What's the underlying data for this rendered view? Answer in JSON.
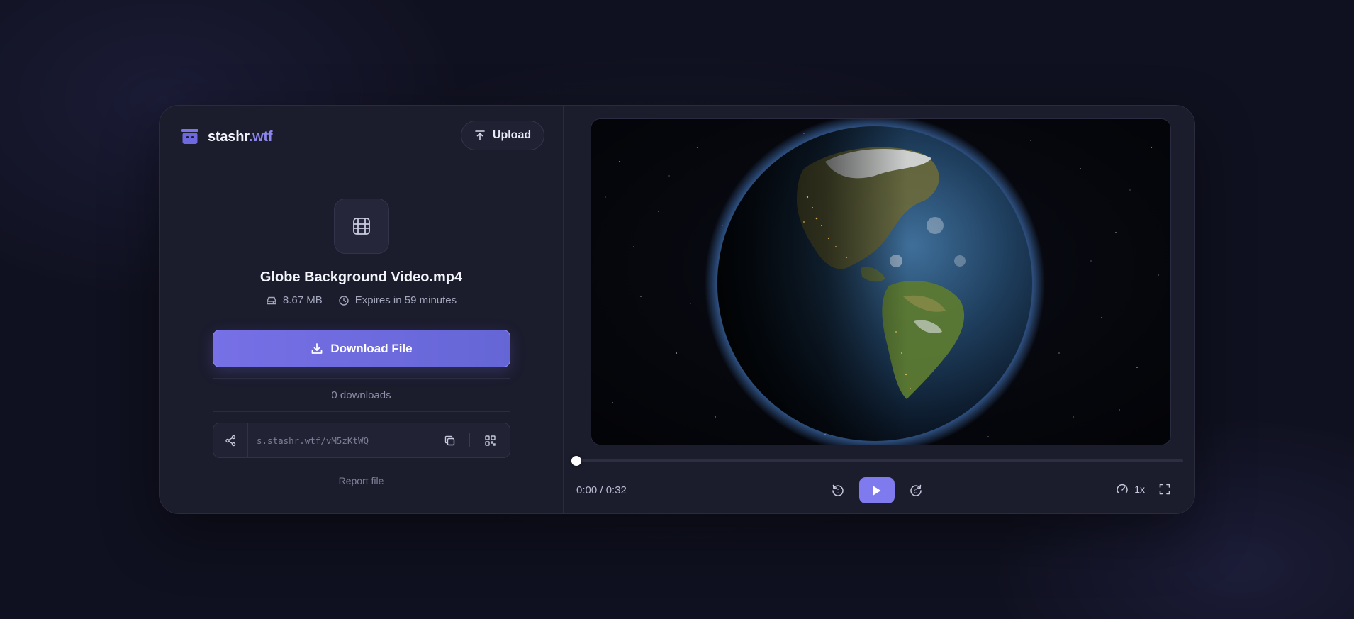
{
  "brand": {
    "name": "stashr",
    "tld": ".wtf"
  },
  "header": {
    "upload_label": "Upload"
  },
  "file": {
    "icon": "film-icon",
    "name": "Globe Background Video.mp4",
    "size": "8.67 MB",
    "expiry": "Expires in 59 minutes"
  },
  "actions": {
    "download_label": "Download File"
  },
  "stats": {
    "downloads": "0 downloads"
  },
  "share": {
    "url": "s.stashr.wtf/vM5zKtWQ"
  },
  "footer": {
    "report_label": "Report file"
  },
  "player": {
    "current_time": "0:00",
    "duration": "0:32",
    "time_display": "0:00 / 0:32",
    "progress": 0,
    "skip_back": "5",
    "skip_forward": "5",
    "speed": "1x"
  },
  "colors": {
    "accent": "#7f7aee",
    "background": "#101120",
    "card": "#1b1c2c"
  }
}
